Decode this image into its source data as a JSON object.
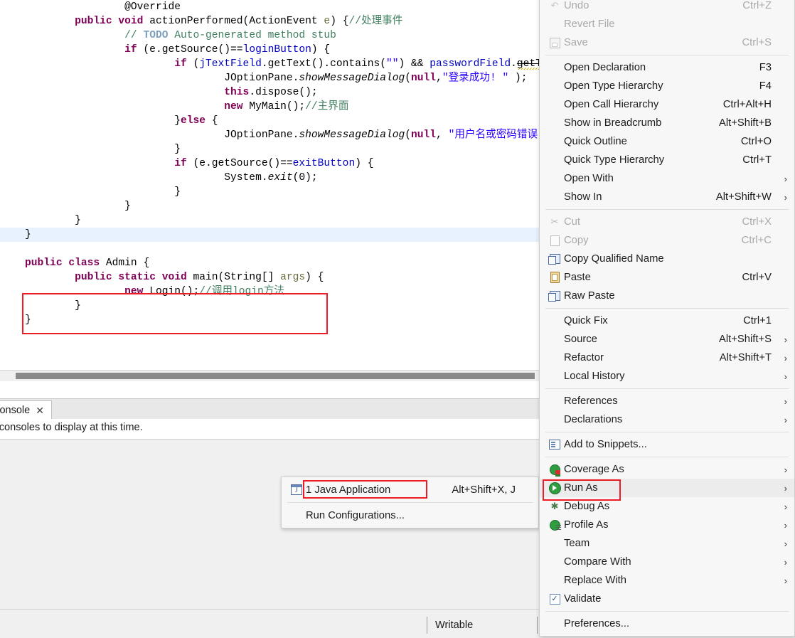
{
  "editor": {
    "lines": [
      {
        "indent": 4,
        "segments": [
          {
            "t": "@Override",
            "c": "plain"
          }
        ]
      },
      {
        "indent": 2,
        "segments": [
          {
            "t": "public",
            "c": "kw"
          },
          {
            "t": " ",
            "c": "plain"
          },
          {
            "t": "void",
            "c": "kw"
          },
          {
            "t": " actionPerformed(ActionEvent ",
            "c": "plain"
          },
          {
            "t": "e",
            "c": "param"
          },
          {
            "t": ") {",
            "c": "plain"
          },
          {
            "t": "//处理事件",
            "c": "cmt"
          }
        ]
      },
      {
        "indent": 4,
        "segments": [
          {
            "t": "// ",
            "c": "cmt"
          },
          {
            "t": "TODO",
            "c": "cmt-tag"
          },
          {
            "t": " Auto-generated method stub",
            "c": "cmt"
          }
        ]
      },
      {
        "indent": 4,
        "segments": [
          {
            "t": "if",
            "c": "kw"
          },
          {
            "t": " (e.getSource()==",
            "c": "plain"
          },
          {
            "t": "loginButton",
            "c": "fld"
          },
          {
            "t": ") {",
            "c": "plain"
          }
        ]
      },
      {
        "indent": 6,
        "segments": [
          {
            "t": "if",
            "c": "kw"
          },
          {
            "t": " (",
            "c": "plain"
          },
          {
            "t": "jTextField",
            "c": "fld"
          },
          {
            "t": ".getText().contains(",
            "c": "plain"
          },
          {
            "t": "\"\"",
            "c": "str"
          },
          {
            "t": ") && ",
            "c": "plain"
          },
          {
            "t": "passwordField",
            "c": "fld"
          },
          {
            "t": ".",
            "c": "plain"
          },
          {
            "t": "getText",
            "c": "strike-squig"
          },
          {
            "t": "()",
            "c": "plain"
          }
        ]
      },
      {
        "indent": 8,
        "segments": [
          {
            "t": "JOptionPane.",
            "c": "plain"
          },
          {
            "t": "showMessageDialog",
            "c": "ital"
          },
          {
            "t": "(",
            "c": "plain"
          },
          {
            "t": "null",
            "c": "kw"
          },
          {
            "t": ",",
            "c": "plain"
          },
          {
            "t": "\"登录成功! \"",
            "c": "str"
          },
          {
            "t": " );",
            "c": "plain"
          }
        ]
      },
      {
        "indent": 8,
        "segments": [
          {
            "t": "this",
            "c": "kw"
          },
          {
            "t": ".dispose();",
            "c": "plain"
          }
        ]
      },
      {
        "indent": 8,
        "segments": [
          {
            "t": "new",
            "c": "kw"
          },
          {
            "t": " MyMain();",
            "c": "plain"
          },
          {
            "t": "//主界面",
            "c": "cmt"
          }
        ]
      },
      {
        "indent": 6,
        "segments": [
          {
            "t": "}",
            "c": "plain"
          },
          {
            "t": "else",
            "c": "kw"
          },
          {
            "t": " {",
            "c": "plain"
          }
        ]
      },
      {
        "indent": 8,
        "segments": [
          {
            "t": "JOptionPane.",
            "c": "plain"
          },
          {
            "t": "showMessageDialog",
            "c": "ital"
          },
          {
            "t": "(",
            "c": "plain"
          },
          {
            "t": "null",
            "c": "kw"
          },
          {
            "t": ", ",
            "c": "plain"
          },
          {
            "t": "\"用户名或密码错误! \"",
            "c": "str"
          },
          {
            "t": ");",
            "c": "plain"
          }
        ]
      },
      {
        "indent": 6,
        "segments": [
          {
            "t": "}",
            "c": "plain"
          }
        ]
      },
      {
        "indent": 6,
        "segments": [
          {
            "t": "if",
            "c": "kw"
          },
          {
            "t": " (e.getSource()==",
            "c": "plain"
          },
          {
            "t": "exitButton",
            "c": "fld"
          },
          {
            "t": ") {",
            "c": "plain"
          }
        ]
      },
      {
        "indent": 8,
        "segments": [
          {
            "t": "System.",
            "c": "plain"
          },
          {
            "t": "exit",
            "c": "ital"
          },
          {
            "t": "(0);",
            "c": "plain"
          }
        ]
      },
      {
        "indent": 6,
        "segments": [
          {
            "t": "}",
            "c": "plain"
          }
        ]
      },
      {
        "indent": 4,
        "segments": [
          {
            "t": "}",
            "c": "plain"
          }
        ]
      },
      {
        "indent": 2,
        "segments": [
          {
            "t": "}",
            "c": "plain"
          }
        ]
      },
      {
        "indent": 0,
        "highlight": true,
        "segments": [
          {
            "t": "}",
            "c": "plain"
          }
        ]
      },
      {
        "indent": 0,
        "segments": []
      },
      {
        "indent": 0,
        "segments": [
          {
            "t": "public",
            "c": "kw"
          },
          {
            "t": " ",
            "c": "plain"
          },
          {
            "t": "class",
            "c": "kw"
          },
          {
            "t": " Admin {",
            "c": "plain"
          }
        ]
      },
      {
        "indent": 2,
        "segments": [
          {
            "t": "public",
            "c": "kw"
          },
          {
            "t": " ",
            "c": "plain"
          },
          {
            "t": "static",
            "c": "kw"
          },
          {
            "t": " ",
            "c": "plain"
          },
          {
            "t": "void",
            "c": "kw"
          },
          {
            "t": " main(String[] ",
            "c": "plain"
          },
          {
            "t": "args",
            "c": "param"
          },
          {
            "t": ") {",
            "c": "plain"
          }
        ]
      },
      {
        "indent": 4,
        "segments": [
          {
            "t": "new",
            "c": "kw"
          },
          {
            "t": " Login();",
            "c": "plain"
          },
          {
            "t": "//调用login方法",
            "c": "cmt"
          }
        ]
      },
      {
        "indent": 2,
        "segments": [
          {
            "t": "}",
            "c": "plain"
          }
        ]
      },
      {
        "indent": 0,
        "segments": [
          {
            "t": "}",
            "c": "plain"
          }
        ]
      }
    ]
  },
  "console": {
    "tab_label": "Console",
    "close_glyph": "✕",
    "empty_message": "No consoles to display at this time."
  },
  "status": {
    "writable": "Writable"
  },
  "context_menu": {
    "groups": [
      {
        "items": [
          {
            "label": "Undo",
            "accel": "Ctrl+Z",
            "icon": "undo-icon",
            "disabled": true,
            "arrow": false
          },
          {
            "label": "Revert File",
            "accel": "",
            "icon": "",
            "disabled": true,
            "arrow": false
          },
          {
            "label": "Save",
            "accel": "Ctrl+S",
            "icon": "save-icon",
            "disabled": true,
            "arrow": false
          }
        ]
      },
      {
        "items": [
          {
            "label": "Open Declaration",
            "accel": "F3",
            "icon": "",
            "disabled": false,
            "arrow": false
          },
          {
            "label": "Open Type Hierarchy",
            "accel": "F4",
            "icon": "",
            "disabled": false,
            "arrow": false
          },
          {
            "label": "Open Call Hierarchy",
            "accel": "Ctrl+Alt+H",
            "icon": "",
            "disabled": false,
            "arrow": false
          },
          {
            "label": "Show in Breadcrumb",
            "accel": "Alt+Shift+B",
            "icon": "",
            "disabled": false,
            "arrow": false
          },
          {
            "label": "Quick Outline",
            "accel": "Ctrl+O",
            "icon": "",
            "disabled": false,
            "arrow": false
          },
          {
            "label": "Quick Type Hierarchy",
            "accel": "Ctrl+T",
            "icon": "",
            "disabled": false,
            "arrow": false
          },
          {
            "label": "Open With",
            "accel": "",
            "icon": "",
            "disabled": false,
            "arrow": true
          },
          {
            "label": "Show In",
            "accel": "Alt+Shift+W",
            "icon": "",
            "disabled": false,
            "arrow": true
          }
        ]
      },
      {
        "items": [
          {
            "label": "Cut",
            "accel": "Ctrl+X",
            "icon": "cut-icon",
            "disabled": true,
            "arrow": false
          },
          {
            "label": "Copy",
            "accel": "Ctrl+C",
            "icon": "copy-icon",
            "disabled": true,
            "arrow": false
          },
          {
            "label": "Copy Qualified Name",
            "accel": "",
            "icon": "copy-qualified-icon",
            "disabled": false,
            "arrow": false
          },
          {
            "label": "Paste",
            "accel": "Ctrl+V",
            "icon": "paste-icon",
            "disabled": false,
            "arrow": false
          },
          {
            "label": "Raw Paste",
            "accel": "",
            "icon": "raw-paste-icon",
            "disabled": false,
            "arrow": false
          }
        ]
      },
      {
        "items": [
          {
            "label": "Quick Fix",
            "accel": "Ctrl+1",
            "icon": "",
            "disabled": false,
            "arrow": false
          },
          {
            "label": "Source",
            "accel": "Alt+Shift+S",
            "icon": "",
            "disabled": false,
            "arrow": true
          },
          {
            "label": "Refactor",
            "accel": "Alt+Shift+T",
            "icon": "",
            "disabled": false,
            "arrow": true
          },
          {
            "label": "Local History",
            "accel": "",
            "icon": "",
            "disabled": false,
            "arrow": true
          }
        ]
      },
      {
        "items": [
          {
            "label": "References",
            "accel": "",
            "icon": "",
            "disabled": false,
            "arrow": true
          },
          {
            "label": "Declarations",
            "accel": "",
            "icon": "",
            "disabled": false,
            "arrow": true
          }
        ]
      },
      {
        "items": [
          {
            "label": "Add to Snippets...",
            "accel": "",
            "icon": "snippets-icon",
            "disabled": false,
            "arrow": false
          }
        ]
      },
      {
        "items": [
          {
            "label": "Coverage As",
            "accel": "",
            "icon": "coverage-icon",
            "disabled": false,
            "arrow": true
          },
          {
            "label": "Run As",
            "accel": "",
            "icon": "run-icon",
            "disabled": false,
            "arrow": true,
            "selected": true,
            "highlighted": true
          },
          {
            "label": "Debug As",
            "accel": "",
            "icon": "debug-icon",
            "disabled": false,
            "arrow": true
          },
          {
            "label": "Profile As",
            "accel": "",
            "icon": "profile-icon",
            "disabled": false,
            "arrow": true
          },
          {
            "label": "Team",
            "accel": "",
            "icon": "",
            "disabled": false,
            "arrow": true
          },
          {
            "label": "Compare With",
            "accel": "",
            "icon": "",
            "disabled": false,
            "arrow": true
          },
          {
            "label": "Replace With",
            "accel": "",
            "icon": "",
            "disabled": false,
            "arrow": true
          },
          {
            "label": "Validate",
            "accel": "",
            "icon": "validate-icon",
            "disabled": false,
            "arrow": false
          }
        ]
      },
      {
        "items": [
          {
            "label": "Preferences...",
            "accel": "",
            "icon": "",
            "disabled": false,
            "arrow": false
          }
        ]
      }
    ]
  },
  "run_submenu": {
    "groups": [
      {
        "items": [
          {
            "label": "1 Java Application",
            "accel": "Alt+Shift+X, J",
            "icon": "java-app-icon",
            "disabled": false,
            "arrow": false,
            "highlighted": true
          }
        ]
      },
      {
        "items": [
          {
            "label": "Run Configurations...",
            "accel": "",
            "icon": "",
            "disabled": false,
            "arrow": false
          }
        ]
      }
    ]
  },
  "colors": {
    "annotation_red": "#ee1c25",
    "keyword_purple": "#7f0055",
    "comment_green": "#3f7f5f",
    "string_blue": "#2a00ff",
    "field_blue": "#0000c0",
    "line_highlight": "#e8f2fe",
    "menu_bg": "#f7f7f7",
    "run_icon_green": "#2f9e41"
  }
}
